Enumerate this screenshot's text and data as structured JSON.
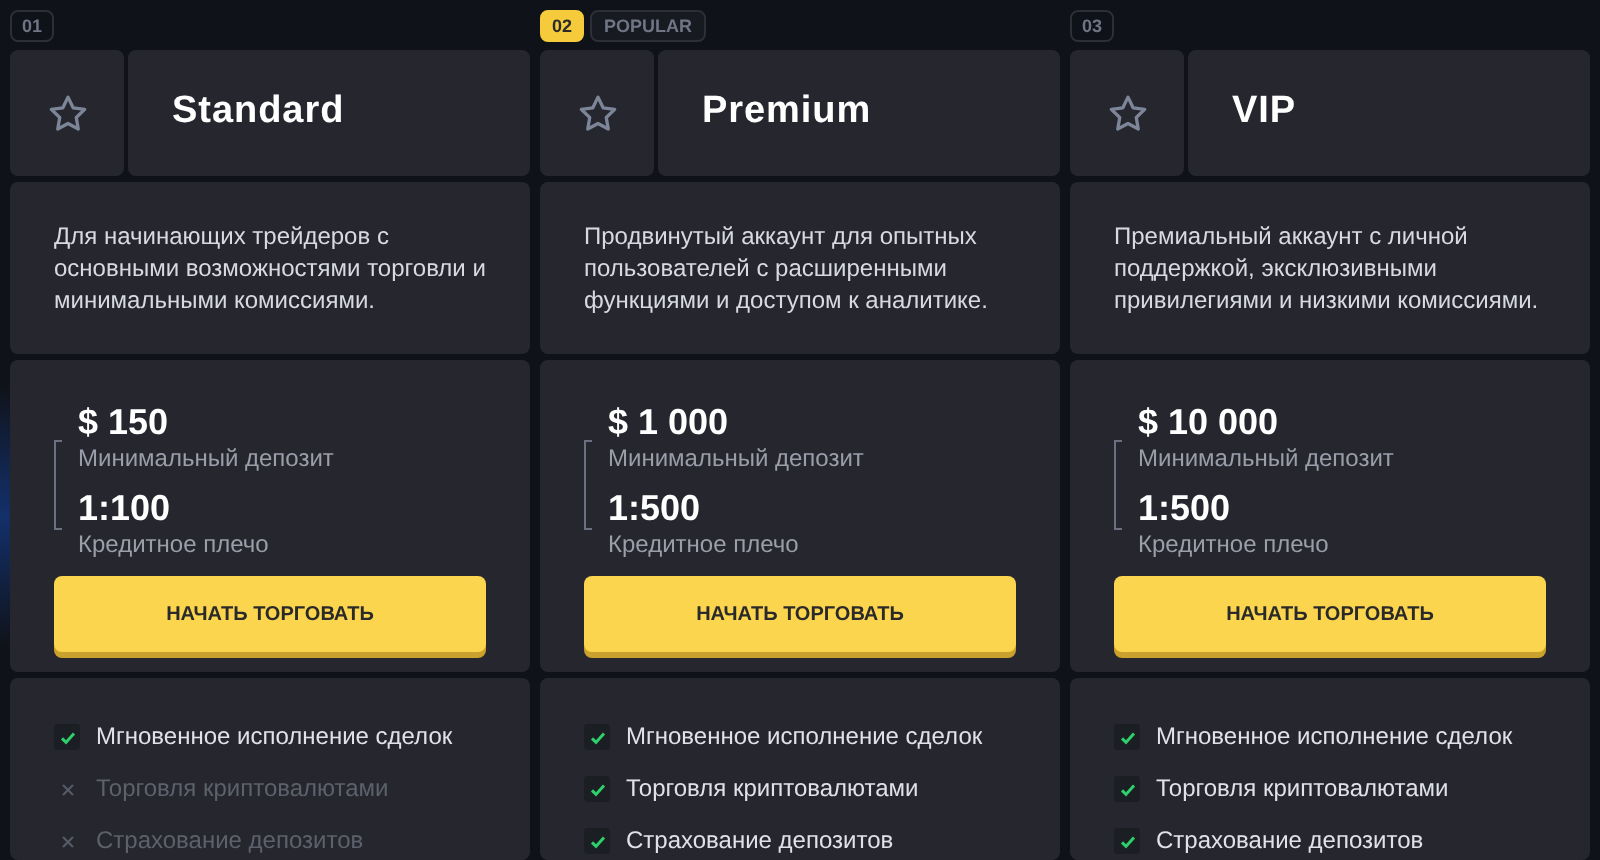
{
  "plans": [
    {
      "number": "01",
      "highlighted": false,
      "name": "Standard",
      "description": "Для начинающих трейдеров с основными возможностями торговли и минимальными комиссиями.",
      "deposit": "$ 150",
      "deposit_label": "Минимальный депозит",
      "leverage": "1:100",
      "leverage_label": "Кредитное плечо",
      "button": "НАЧАТЬ ТОРГОВАТЬ",
      "features": [
        {
          "label": "Мгновенное исполнение сделок",
          "checked": true
        },
        {
          "label": "Торговля криптовалютами",
          "checked": false
        },
        {
          "label": "Страхование депозитов",
          "checked": false
        }
      ]
    },
    {
      "number": "02",
      "highlighted": true,
      "tag": "POPULAR",
      "name": "Premium",
      "description": "Продвинутый аккаунт для опытных пользователей с расширенными функциями и доступом к аналитике.",
      "deposit": "$ 1 000",
      "deposit_label": "Минимальный депозит",
      "leverage": "1:500",
      "leverage_label": "Кредитное плечо",
      "button": "НАЧАТЬ ТОРГОВАТЬ",
      "features": [
        {
          "label": "Мгновенное исполнение сделок",
          "checked": true
        },
        {
          "label": "Торговля криптовалютами",
          "checked": true
        },
        {
          "label": "Страхование депозитов",
          "checked": true
        }
      ]
    },
    {
      "number": "03",
      "highlighted": false,
      "name": "VIP",
      "description": "Премиальный аккаунт с личной поддержкой, эксклюзивными привилегиями и низкими комиссиями.",
      "deposit": "$ 10 000",
      "deposit_label": "Минимальный депозит",
      "leverage": "1:500",
      "leverage_label": "Кредитное плечо",
      "button": "НАЧАТЬ ТОРГОВАТЬ",
      "features": [
        {
          "label": "Мгновенное исполнение сделок",
          "checked": true
        },
        {
          "label": "Торговля криптовалютами",
          "checked": true
        },
        {
          "label": "Страхование депозитов",
          "checked": true
        }
      ]
    }
  ]
}
